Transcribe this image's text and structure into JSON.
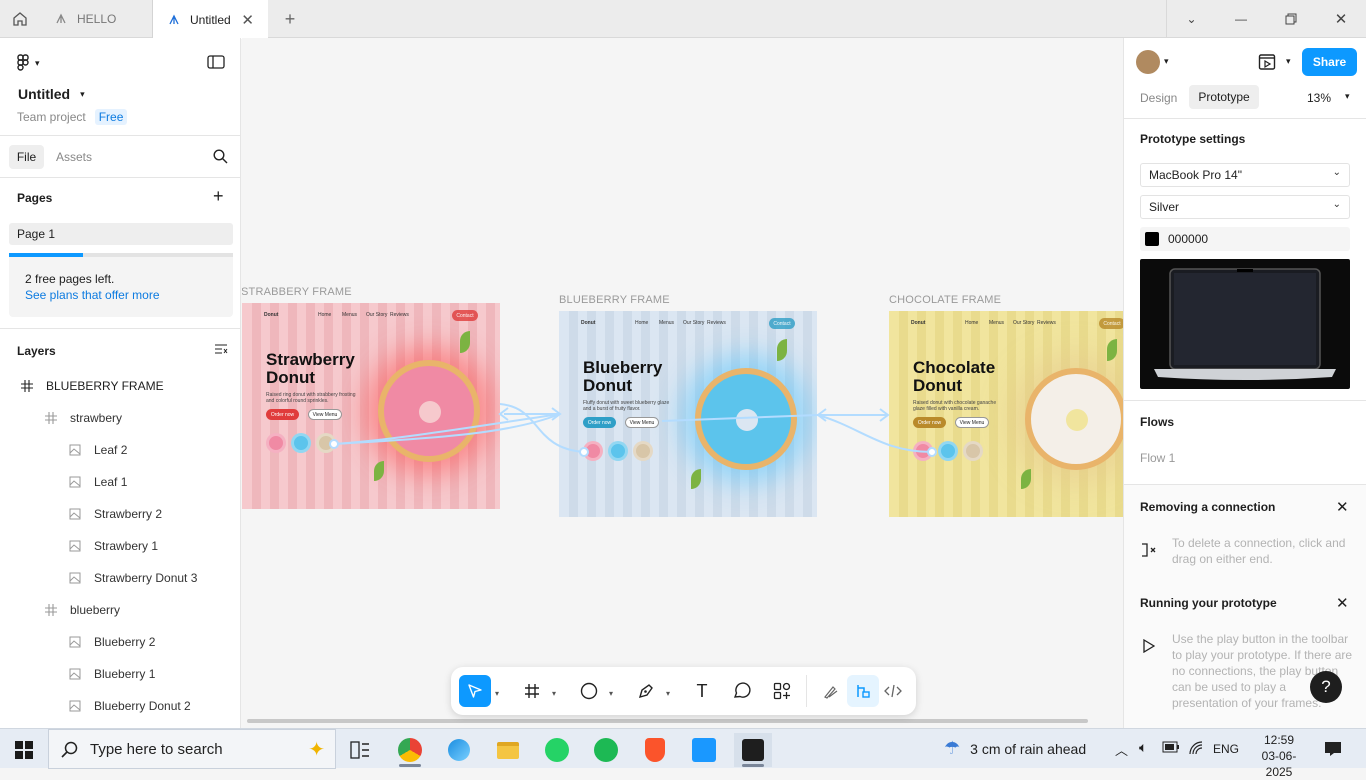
{
  "tabs": [
    {
      "label": "HELLO"
    },
    {
      "label": "Untitled"
    }
  ],
  "file": {
    "title": "Untitled",
    "team": "Team project",
    "plan_badge": "Free"
  },
  "left_tabs": {
    "file": "File",
    "assets": "Assets"
  },
  "pages": {
    "header": "Pages",
    "items": [
      "Page 1"
    ],
    "free_notice": "2 free pages left.",
    "plans_link": "See plans that offer more"
  },
  "layers": {
    "header": "Layers",
    "items": [
      {
        "label": "BLUEBERRY FRAME",
        "type": "frame"
      },
      {
        "label": "strawbery",
        "type": "frame"
      },
      {
        "label": "Leaf 2",
        "type": "image"
      },
      {
        "label": "Leaf 1",
        "type": "image"
      },
      {
        "label": "Strawberry 2",
        "type": "image"
      },
      {
        "label": "Strawbery 1",
        "type": "image"
      },
      {
        "label": "Strawberry Donut 3",
        "type": "image"
      },
      {
        "label": "blueberry",
        "type": "frame"
      },
      {
        "label": "Blueberry 2",
        "type": "image"
      },
      {
        "label": "Blueberry 1",
        "type": "image"
      },
      {
        "label": "Blueberry Donut 2",
        "type": "image"
      }
    ]
  },
  "canvas": {
    "frames": [
      {
        "label": "STRABBERY FRAME",
        "title_line1": "Strawberry",
        "title_line2": "Donut",
        "desc": "Raised ring donut with strabbery frosting and colorful round sprinkles.",
        "order": "Order now",
        "menu": "View Menu",
        "brand": "Donut",
        "nav": [
          "Home",
          "Menus",
          "Our Story",
          "Reviews"
        ],
        "contact": "Contact",
        "bg": "#f6c9cd",
        "stripe": "#e9a8ae",
        "accent": "#e03c3c"
      },
      {
        "label": "BLUEBERRY FRAME",
        "title_line1": "Blueberry",
        "title_line2": "Donut",
        "desc": "Fluffy donut with sweet blueberry glaze and a burst of fruity flavor.",
        "order": "Order now",
        "menu": "View Menu",
        "brand": "Donut",
        "nav": [
          "Home",
          "Menus",
          "Our Story",
          "Reviews"
        ],
        "contact": "Contact",
        "bg": "#dbe6f2",
        "stripe": "#c3d1e2",
        "accent": "#2f9fc7"
      },
      {
        "label": "CHOCOLATE FRAME",
        "title_line1": "Chocolate",
        "title_line2": "Donut",
        "desc": "Raised donut with chocolate ganache glaze filled with vanilla cream.",
        "order": "Order now",
        "menu": "View Menu",
        "brand": "Donut",
        "nav": [
          "Home",
          "Menus",
          "Our Story",
          "Reviews"
        ],
        "contact": "Contact",
        "bg": "#f1e59e",
        "stripe": "#e2d47f",
        "accent": "#b98a2a"
      }
    ]
  },
  "header_right": {
    "share": "Share",
    "design_tab": "Design",
    "prototype_tab": "Prototype",
    "zoom": "13%"
  },
  "prototype": {
    "settings_header": "Prototype settings",
    "device": "MacBook Pro 14\"",
    "model": "Silver",
    "bg_color_hex": "000000",
    "flows_header": "Flows",
    "flow_item": "Flow 1",
    "removing_header": "Removing a connection",
    "removing_text": "To delete a connection, click and drag on either end.",
    "running_header": "Running your prototype",
    "running_text": "Use the play button in the toolbar to play your prototype. If there are no connections, the play button can be used to play a presentation of your frames."
  },
  "taskbar": {
    "search_placeholder": "Type here to search",
    "weather": "3 cm of rain ahead",
    "lang": "ENG",
    "time": "12:59",
    "date": "03-06-2025"
  },
  "colors": {
    "accent": "#0d99ff",
    "share": "#0d99ff",
    "link": "#0d7be0"
  }
}
